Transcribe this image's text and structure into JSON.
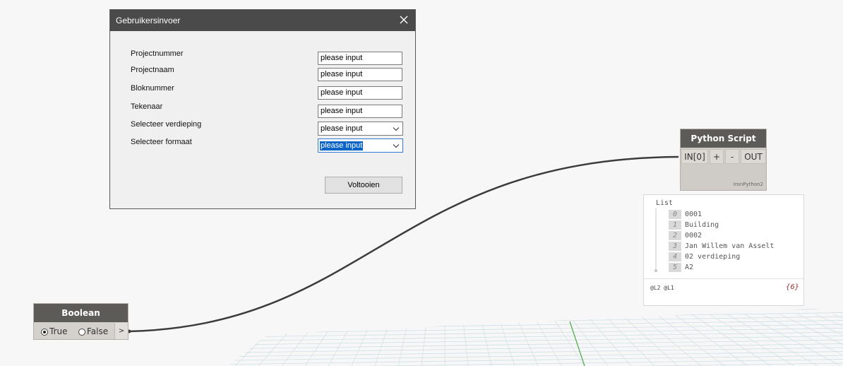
{
  "dialog": {
    "title": "Gebruikersinvoer",
    "fields": [
      {
        "label": "Projectnummer",
        "value": "please input"
      },
      {
        "label": "Projectnaam",
        "value": "please input"
      },
      {
        "label": "Bloknummer",
        "value": "please input"
      },
      {
        "label": "Tekenaar",
        "value": "please input"
      }
    ],
    "combos": [
      {
        "label": "Selecteer verdieping",
        "value": "please input"
      },
      {
        "label": "Selecteer formaat",
        "value": "please input"
      }
    ],
    "submit_label": "Voltooien"
  },
  "python_node": {
    "title": "Python Script",
    "input_port": "IN[0]",
    "add_label": "+",
    "remove_label": "-",
    "output_port": "OUT",
    "engine": "IronPython2"
  },
  "watch": {
    "list_title": "List",
    "items": [
      {
        "index": "0",
        "value": "0001"
      },
      {
        "index": "1",
        "value": "Building"
      },
      {
        "index": "2",
        "value": "0002"
      },
      {
        "index": "3",
        "value": "Jan Willem van Asselt"
      },
      {
        "index": "4",
        "value": "02 verdieping"
      },
      {
        "index": "5",
        "value": "A2"
      }
    ],
    "levels": "@L2 @L1",
    "count": "{6}"
  },
  "boolean_node": {
    "title": "Boolean",
    "true_label": "True",
    "false_label": "False",
    "selected": "True",
    "output_label": ">"
  },
  "colors": {
    "node_header": "#5d5b58",
    "node_body": "#cfcbc6",
    "wire": "#3c3c3c",
    "selection": "#0a64c8",
    "grid": "#c9dde3"
  }
}
